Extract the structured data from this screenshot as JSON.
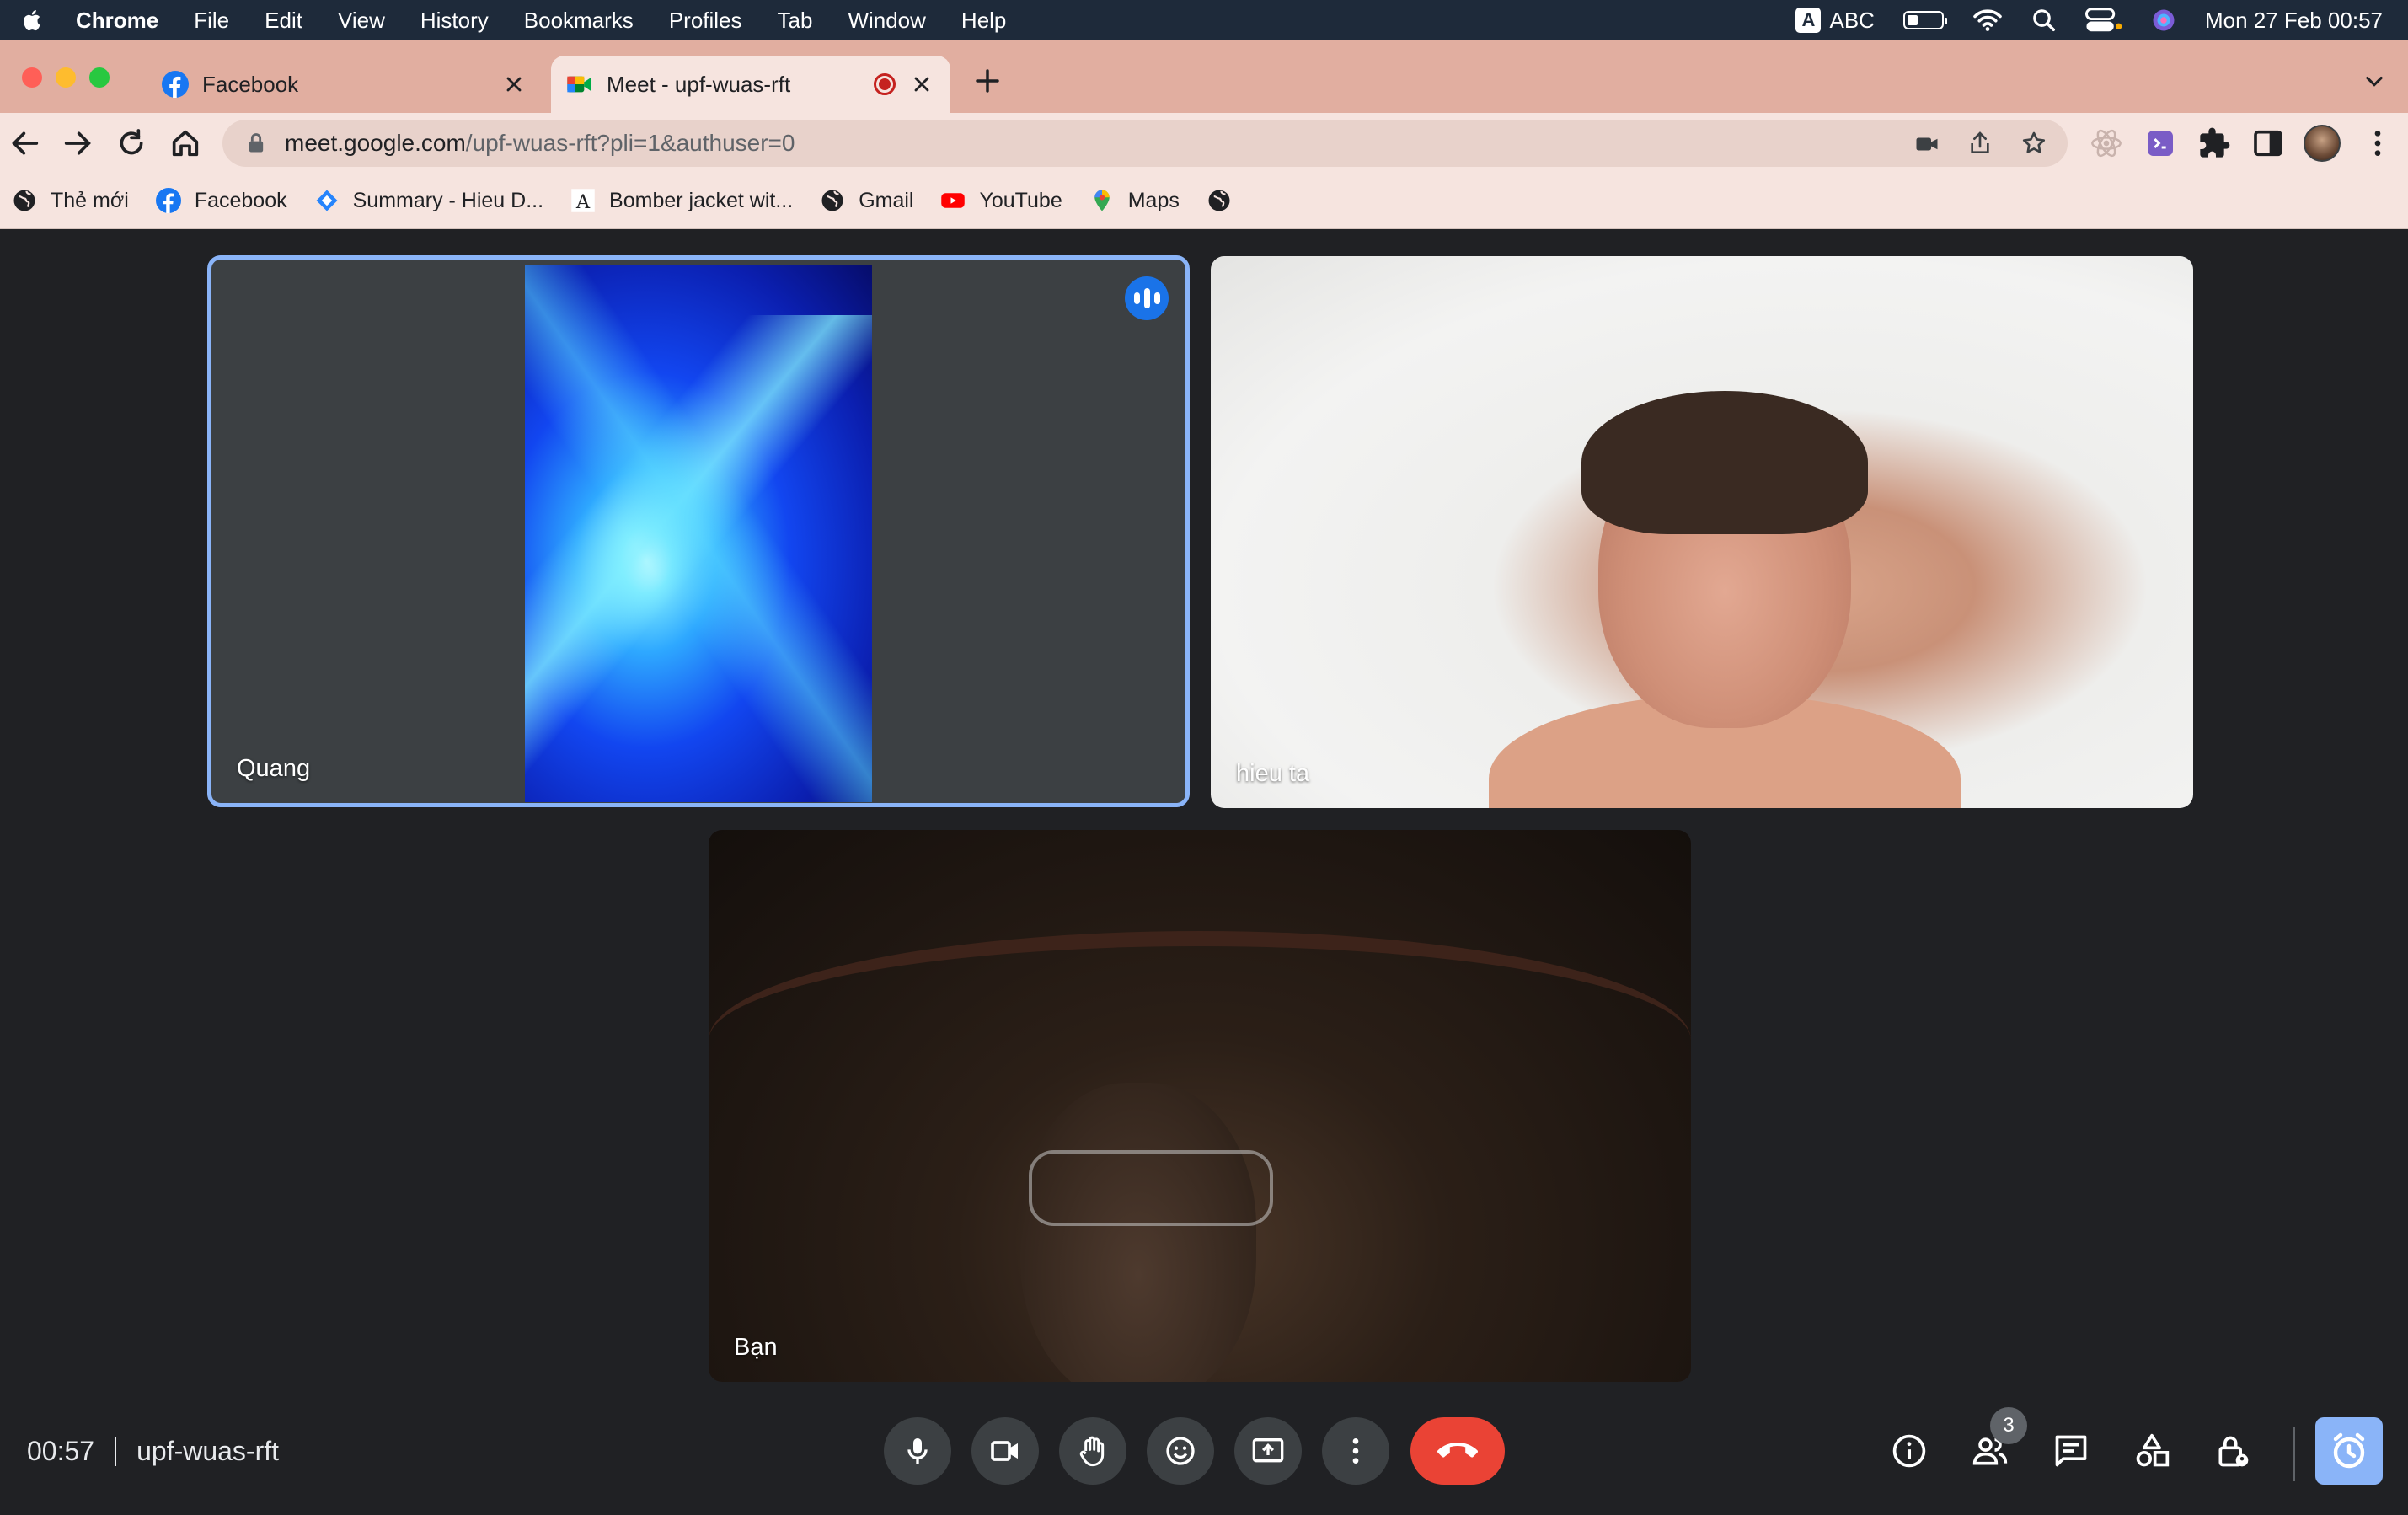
{
  "menubar": {
    "app_name": "Chrome",
    "items": [
      "File",
      "Edit",
      "View",
      "History",
      "Bookmarks",
      "Profiles",
      "Tab",
      "Window",
      "Help"
    ],
    "input_source": "ABC",
    "input_badge": "A",
    "datetime": "Mon 27 Feb  00:57"
  },
  "tabs": [
    {
      "title": "Facebook",
      "favicon": "facebook-icon",
      "active": false
    },
    {
      "title": "Meet - upf-wuas-rft",
      "favicon": "google-meet-icon",
      "active": true,
      "recording": true
    }
  ],
  "omnibox": {
    "host": "meet.google.com",
    "path": "/upf-wuas-rft?pli=1&authuser=0"
  },
  "bookmarks": [
    {
      "label": "Thẻ mới",
      "icon": "globe-icon"
    },
    {
      "label": "Facebook",
      "icon": "facebook-icon"
    },
    {
      "label": "Summary - Hieu D...",
      "icon": "diamond-icon"
    },
    {
      "label": "Bomber jacket wit...",
      "icon": "a-serif-icon"
    },
    {
      "label": "Gmail",
      "icon": "globe-icon"
    },
    {
      "label": "YouTube",
      "icon": "youtube-icon"
    },
    {
      "label": "Maps",
      "icon": "maps-pin-icon"
    }
  ],
  "participants": [
    {
      "name": "Quang",
      "speaking": true
    },
    {
      "name": "hieu ta",
      "speaking": false
    },
    {
      "name": "Bạn",
      "speaking": false
    }
  ],
  "bottom_bar": {
    "time": "00:57",
    "meeting_code": "upf-wuas-rft",
    "people_count": "3",
    "controls": [
      "microphone-icon",
      "camera-icon",
      "raise-hand-icon",
      "emoji-icon",
      "present-screen-icon",
      "more-options-icon",
      "hang-up-icon"
    ],
    "side_controls": [
      "info-icon",
      "people-icon",
      "chat-icon",
      "activities-icon",
      "host-controls-icon",
      "timer-icon"
    ]
  },
  "colors": {
    "meet_background": "#202124",
    "tab_strip": "#e1aea0",
    "toolbar": "#f6e4df",
    "speaker_border": "#8ab4f8",
    "hang_up": "#ea4335",
    "active_side_button": "#8ab4f8"
  }
}
